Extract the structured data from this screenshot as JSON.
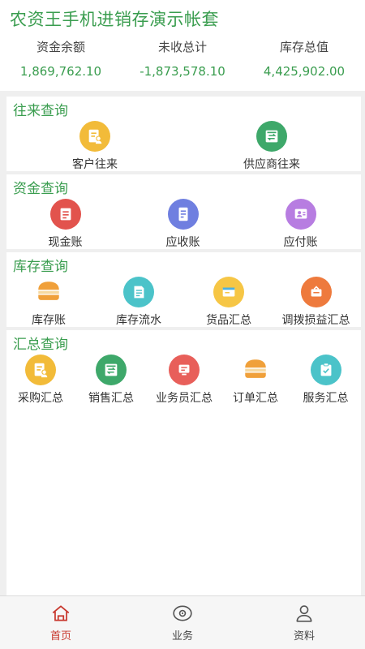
{
  "header": {
    "title": "农资王手机进销存演示帐套",
    "stats": [
      {
        "label": "资金余额",
        "value": "1,869,762.10"
      },
      {
        "label": "未收总计",
        "value": "-1,873,578.10"
      },
      {
        "label": "库存总值",
        "value": "4,425,902.00"
      }
    ]
  },
  "sections": {
    "dealings": {
      "title": "往来查询",
      "items": [
        {
          "label": "客户往来",
          "icon": "customer-doc-icon",
          "color": "#f2bb39"
        },
        {
          "label": "供应商往来",
          "icon": "supplier-doc-icon",
          "color": "#3ea86a"
        }
      ]
    },
    "funds": {
      "title": "资金查询",
      "items": [
        {
          "label": "现金账",
          "icon": "cash-ledger-icon",
          "color": "#e2534d"
        },
        {
          "label": "应收账",
          "icon": "receivable-icon",
          "color": "#6f7fe0"
        },
        {
          "label": "应付账",
          "icon": "payable-icon",
          "color": "#b77de1"
        }
      ]
    },
    "inventory": {
      "title": "库存查询",
      "items": [
        {
          "label": "库存账",
          "icon": "stock-ledger-icon",
          "color": "#f0a03a"
        },
        {
          "label": "库存流水",
          "icon": "stock-flow-icon",
          "color": "#4bc3c9"
        },
        {
          "label": "货品汇总",
          "icon": "goods-summary-icon",
          "color": "#f6c645"
        },
        {
          "label": "调拨损益汇总",
          "icon": "transfer-summary-icon",
          "color": "#ee7a3d"
        }
      ]
    },
    "summary": {
      "title": "汇总查询",
      "items": [
        {
          "label": "采购汇总",
          "icon": "purchase-summary-icon",
          "color": "#f2bb39"
        },
        {
          "label": "销售汇总",
          "icon": "sales-summary-icon",
          "color": "#3ea86a"
        },
        {
          "label": "业务员汇总",
          "icon": "salesman-summary-icon",
          "color": "#e85f5a"
        },
        {
          "label": "订单汇总",
          "icon": "order-summary-icon",
          "color": "#f0a03a"
        },
        {
          "label": "服务汇总",
          "icon": "service-summary-icon",
          "color": "#4bc3c9"
        }
      ]
    }
  },
  "tabbar": {
    "items": [
      {
        "label": "首页",
        "icon": "home-icon",
        "active": true
      },
      {
        "label": "业务",
        "icon": "eye-icon",
        "active": false
      },
      {
        "label": "资料",
        "icon": "user-icon",
        "active": false
      }
    ],
    "active_color": "#c8372d"
  }
}
